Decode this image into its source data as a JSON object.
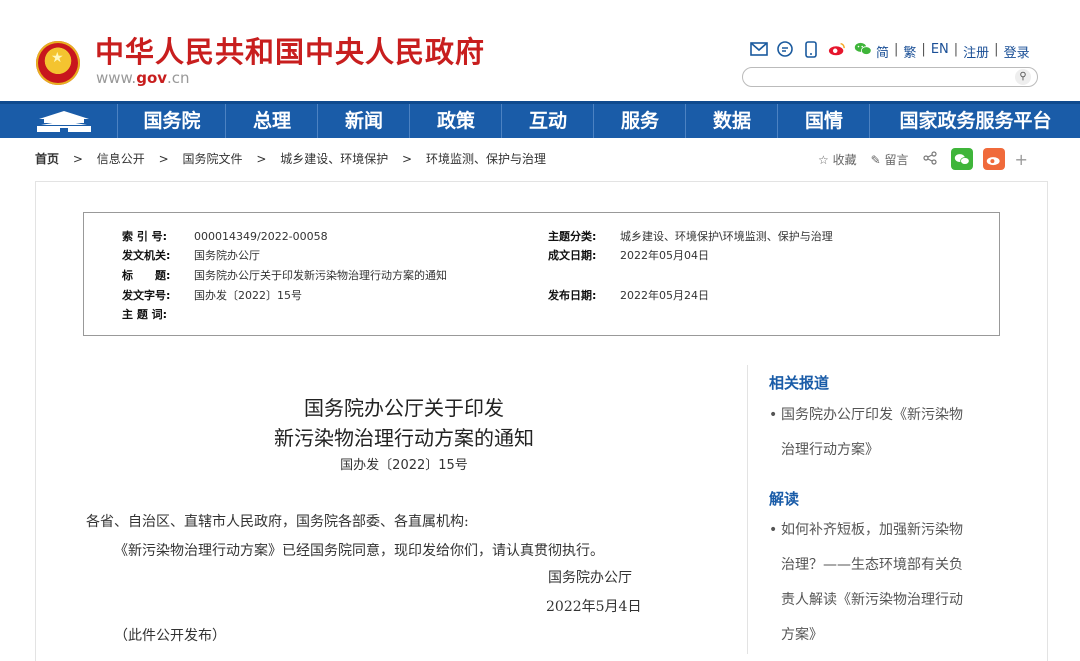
{
  "header": {
    "site_title": "中华人民共和国中央人民政府",
    "url_prefix": "www.",
    "url_brand": "gov",
    "url_suffix": ".cn",
    "icons": [
      "email-icon",
      "message-icon",
      "mobile-icon",
      "weibo-icon",
      "wechat-icon"
    ],
    "lang_links": [
      "简",
      "繁",
      "EN",
      "注册",
      "登录"
    ],
    "search_placeholder": ""
  },
  "nav": {
    "items": [
      "国务院",
      "总理",
      "新闻",
      "政策",
      "互动",
      "服务",
      "数据",
      "国情",
      "国家政务服务平台"
    ]
  },
  "breadcrumb": {
    "items": [
      "首页",
      "信息公开",
      "国务院文件",
      "城乡建设、环境保护",
      "环境监测、保护与治理"
    ],
    "separator": ">"
  },
  "actions": {
    "favorite": "收藏",
    "comment": "留言",
    "plus": "+"
  },
  "info": {
    "index_label": "索 引 号:",
    "index_value": "000014349/2022-00058",
    "issuer_label": "发文机关:",
    "issuer_value": "国务院办公厅",
    "title_label": "标　　题:",
    "title_value": "国务院办公厅关于印发新污染物治理行动方案的通知",
    "doc_no_label": "发文字号:",
    "doc_no_value": "国办发〔2022〕15号",
    "keywords_label": "主 题 词:",
    "keywords_value": "",
    "category_label": "主题分类:",
    "category_value": "城乡建设、环境保护\\环境监测、保护与治理",
    "date_written_label": "成文日期:",
    "date_written_value": "2022年05月04日",
    "date_published_label": "发布日期:",
    "date_published_value": "2022年05月24日"
  },
  "document": {
    "title_line1": "国务院办公厅关于印发",
    "title_line2": "新污染物治理行动方案的通知",
    "doc_no": "国办发〔2022〕15号",
    "salutation": "各省、自治区、直辖市人民政府，国务院各部委、各直属机构:",
    "paragraph": "《新污染物治理行动方案》已经国务院同意，现印发给你们，请认真贯彻执行。",
    "signer": "国务院办公厅",
    "date": "2022年5月4日",
    "note": "（此件公开发布）"
  },
  "sidebar": {
    "related_title": "相关报道",
    "related_lines": [
      "国务院办公厅印发《新污染物",
      "治理行动方案》"
    ],
    "interpret_title": "解读",
    "interpret_lines": [
      "如何补齐短板，加强新污染物",
      "治理？——生态环境部有关负",
      "责人解读《新污染物治理行动",
      "方案》"
    ]
  },
  "colors": {
    "brand_red": "#c81e1e",
    "nav_blue": "#1a5ca8",
    "link_blue": "#1a4f96",
    "wechat_green": "#3fb53a",
    "weibo_orange": "#f06a3b"
  }
}
